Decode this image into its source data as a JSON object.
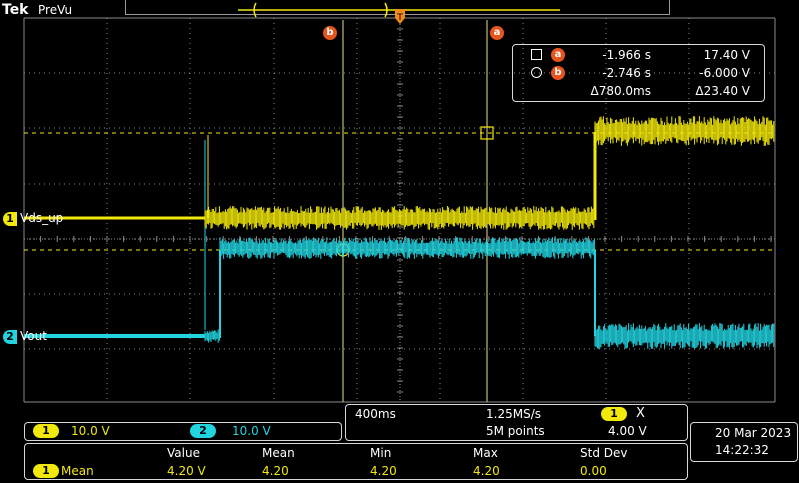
{
  "header": {
    "brand": "Tek",
    "mode": "PreVu"
  },
  "trigger_marker": {
    "label": "T"
  },
  "colors": {
    "ch1": "#f2e80a",
    "ch2": "#22d3e0",
    "grid": "#8a8a8a",
    "cursor_badge": "#e8541e",
    "box_border": "#d8d8d8"
  },
  "cursors": {
    "a": {
      "label": "a",
      "time": "-1.966 s",
      "volt": "17.40 V",
      "symbol": "square"
    },
    "b": {
      "label": "b",
      "time": "-2.746 s",
      "volt": "-6.000 V",
      "symbol": "circle"
    },
    "delta_time": "Δ780.0ms",
    "delta_volt": "Δ23.40 V"
  },
  "channels": [
    {
      "num": "1",
      "name": "Vds_up",
      "scale": "10.0 V"
    },
    {
      "num": "2",
      "name": "Vout",
      "scale": "10.0 V"
    }
  ],
  "horizontal": {
    "time_per_div": "400ms",
    "sample_rate": "1.25MS/s",
    "record_length": "5M points",
    "trigger_source": "1",
    "trigger_symbol": "X",
    "trigger_level": "4.00 V"
  },
  "measurements": {
    "headers": {
      "value": "Value",
      "mean": "Mean",
      "min": "Min",
      "max": "Max",
      "std": "Std Dev"
    },
    "rows": [
      {
        "source": "1",
        "name": "Mean",
        "value": "4.20 V",
        "mean": "4.20",
        "min": "4.20",
        "max": "4.20",
        "std": "0.00"
      }
    ]
  },
  "datetime": {
    "date": "20 Mar  2023",
    "time": "14:22:32"
  }
}
